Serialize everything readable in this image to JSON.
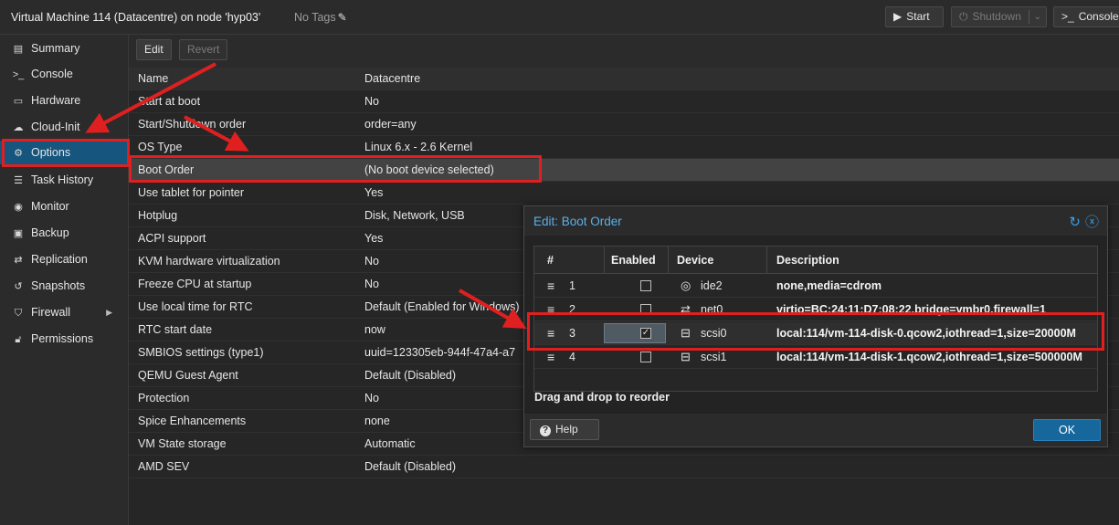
{
  "header": {
    "vm_title": "Virtual Machine 114 (Datacentre) on node 'hyp03'",
    "tags_label": "No Tags",
    "start_label": "Start",
    "shutdown_label": "Shutdown",
    "console_label": "Console"
  },
  "sidebar": {
    "items": [
      {
        "label": "Summary",
        "icon": "book-icon"
      },
      {
        "label": "Console",
        "icon": "terminal-icon"
      },
      {
        "label": "Hardware",
        "icon": "desktop-icon"
      },
      {
        "label": "Cloud-Init",
        "icon": "cloud-icon"
      },
      {
        "label": "Options",
        "icon": "gear-icon"
      },
      {
        "label": "Task History",
        "icon": "list-icon"
      },
      {
        "label": "Monitor",
        "icon": "eye-icon"
      },
      {
        "label": "Backup",
        "icon": "floppy-icon"
      },
      {
        "label": "Replication",
        "icon": "retweet-icon"
      },
      {
        "label": "Snapshots",
        "icon": "history-icon"
      },
      {
        "label": "Firewall",
        "icon": "shield-icon"
      },
      {
        "label": "Permissions",
        "icon": "unlock-icon"
      }
    ]
  },
  "toolbar": {
    "edit_label": "Edit",
    "revert_label": "Revert"
  },
  "options": [
    {
      "key": "Name",
      "value": "Datacentre"
    },
    {
      "key": "Start at boot",
      "value": "No"
    },
    {
      "key": "Start/Shutdown order",
      "value": "order=any"
    },
    {
      "key": "OS Type",
      "value": "Linux 6.x - 2.6 Kernel"
    },
    {
      "key": "Boot Order",
      "value": "(No boot device selected)"
    },
    {
      "key": "Use tablet for pointer",
      "value": "Yes"
    },
    {
      "key": "Hotplug",
      "value": "Disk, Network, USB"
    },
    {
      "key": "ACPI support",
      "value": "Yes"
    },
    {
      "key": "KVM hardware virtualization",
      "value": "No"
    },
    {
      "key": "Freeze CPU at startup",
      "value": "No"
    },
    {
      "key": "Use local time for RTC",
      "value": "Default (Enabled for Windows)"
    },
    {
      "key": "RTC start date",
      "value": "now"
    },
    {
      "key": "SMBIOS settings (type1)",
      "value": "uuid=123305eb-944f-47a4-a7"
    },
    {
      "key": "QEMU Guest Agent",
      "value": "Default (Disabled)"
    },
    {
      "key": "Protection",
      "value": "No"
    },
    {
      "key": "Spice Enhancements",
      "value": "none"
    },
    {
      "key": "VM State storage",
      "value": "Automatic"
    },
    {
      "key": "AMD SEV",
      "value": "Default (Disabled)"
    }
  ],
  "dialog": {
    "title": "Edit: Boot Order",
    "columns": {
      "num": "#",
      "enabled": "Enabled",
      "device": "Device",
      "description": "Description"
    },
    "rows": [
      {
        "num": "1",
        "enabled": false,
        "device": "ide2",
        "device_icon": "disc-icon",
        "description": "none,media=cdrom"
      },
      {
        "num": "2",
        "enabled": false,
        "device": "net0",
        "device_icon": "exchange-icon",
        "description": "virtio=BC:24:11:D7:08:22,bridge=vmbr0,firewall=1"
      },
      {
        "num": "3",
        "enabled": true,
        "device": "scsi0",
        "device_icon": "hdd-icon",
        "description": "local:114/vm-114-disk-0.qcow2,iothread=1,size=20000M"
      },
      {
        "num": "4",
        "enabled": false,
        "device": "scsi1",
        "device_icon": "hdd-icon",
        "description": "local:114/vm-114-disk-1.qcow2,iothread=1,size=500000M"
      }
    ],
    "hint": "Drag and drop to reorder",
    "help_label": "Help",
    "ok_label": "OK"
  }
}
